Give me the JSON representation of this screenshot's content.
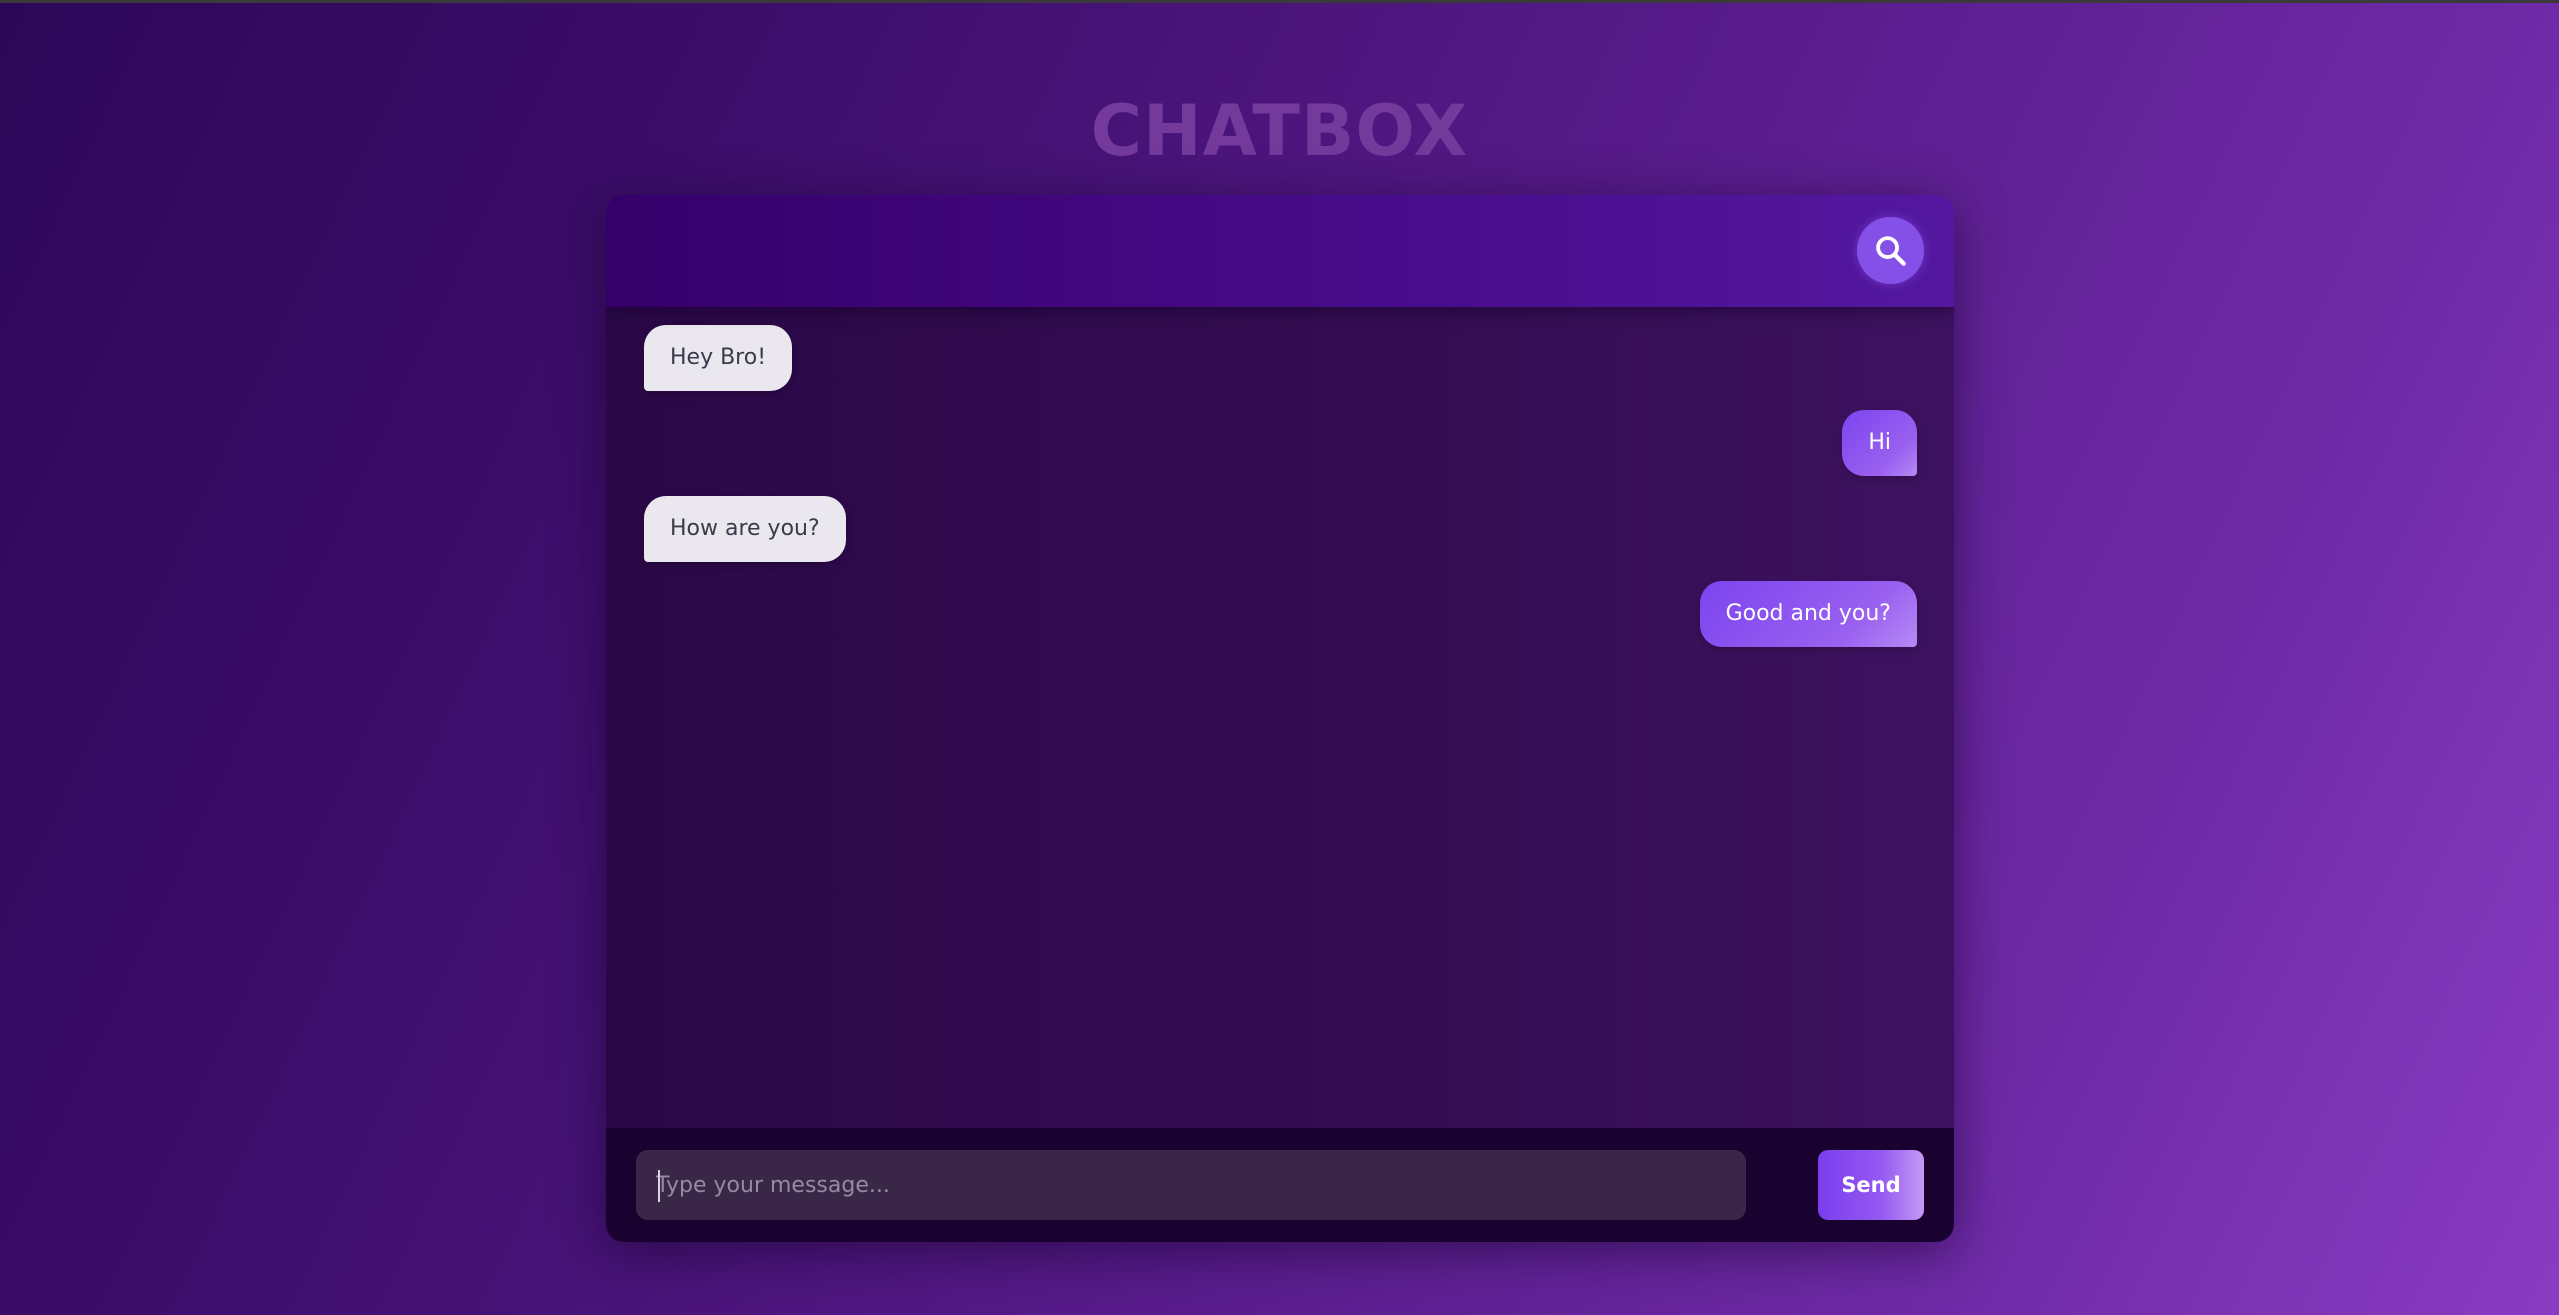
{
  "app": {
    "title": "CHATBOX"
  },
  "header": {
    "search_icon": "search-icon"
  },
  "messages": [
    {
      "sender": "received",
      "text": "Hey Bro!"
    },
    {
      "sender": "sent",
      "text": "Hi"
    },
    {
      "sender": "received",
      "text": "How are you?"
    },
    {
      "sender": "sent",
      "text": "Good and you?"
    }
  ],
  "composer": {
    "input_value": "",
    "placeholder": "Type your message...",
    "send_label": "Send"
  },
  "colors": {
    "accent": "#8550e8",
    "sent_bubble": "#7c44ef",
    "received_bubble": "#ebe7ef",
    "header": "#450a86"
  }
}
